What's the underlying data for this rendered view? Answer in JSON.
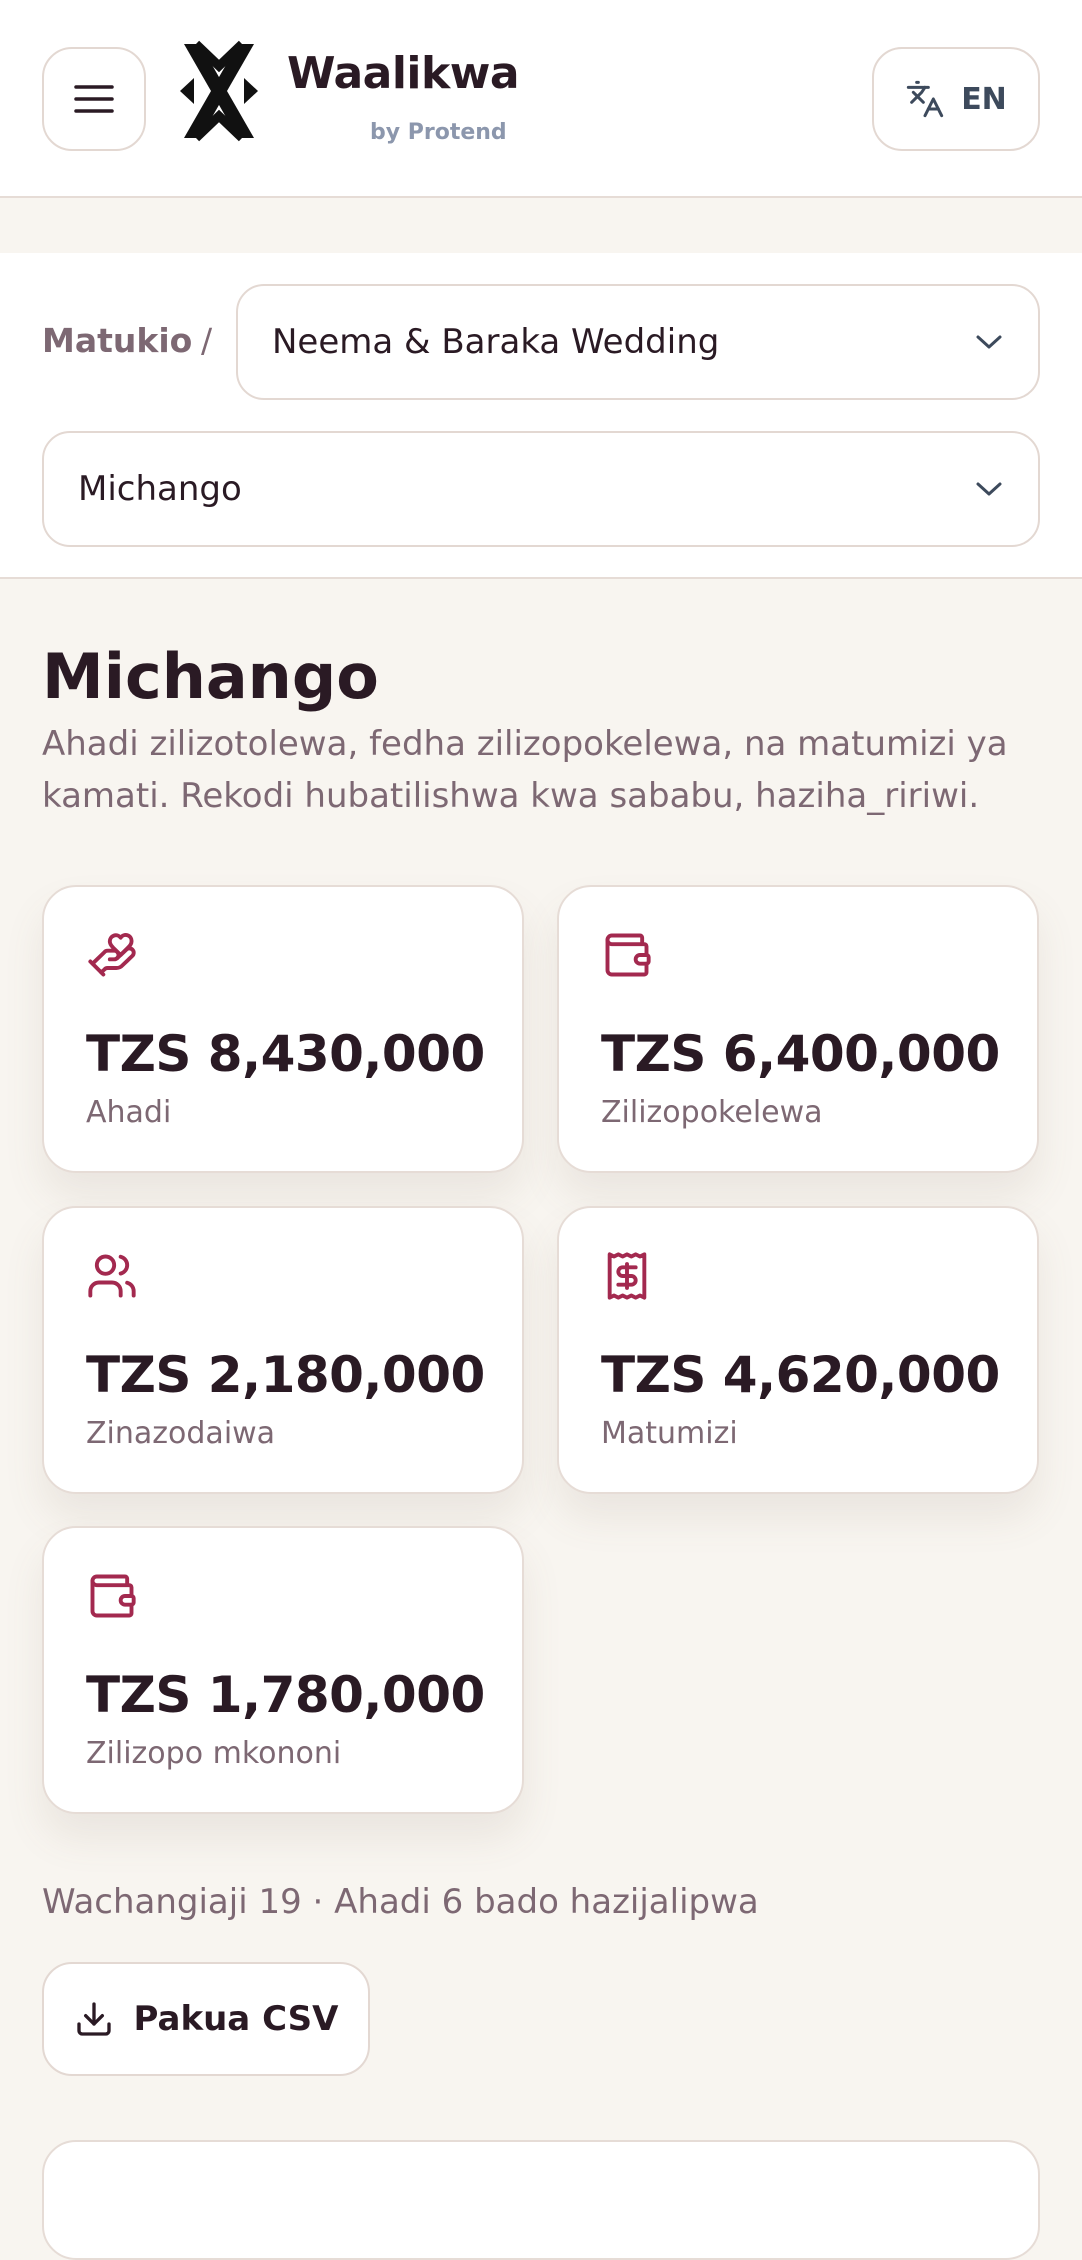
{
  "header": {
    "brand_name": "Waalikwa",
    "brand_sub": "by Protend",
    "language": "EN",
    "menu_icon": "hamburger-menu-icon",
    "language_icon": "translate-icon"
  },
  "subnav": {
    "breadcrumb": "Matukio",
    "separator": "/",
    "event_select": "Neema & Baraka Wedding",
    "section_select": "Michango"
  },
  "page": {
    "title": "Michango",
    "description": "Ahadi zilizotolewa, fedha zilizopokelewa, na matumizi ya kamati. Rekodi hubatilishwa kwa sababu, haziha_ririwi."
  },
  "stats": [
    {
      "icon": "hand-pledge-icon",
      "amount": "TZS 8,430,000",
      "label": "Ahadi"
    },
    {
      "icon": "wallet-icon",
      "amount": "TZS 6,400,000",
      "label": "Zilizopokelewa"
    },
    {
      "icon": "users-icon",
      "amount": "TZS 2,180,000",
      "label": "Zinazodaiwa"
    },
    {
      "icon": "receipt-icon",
      "amount": "TZS 4,620,000",
      "label": "Matumizi"
    },
    {
      "icon": "wallet-icon",
      "amount": "TZS 1,780,000",
      "label": "Zilizopo mkononi"
    }
  ],
  "summary": "Wachangiaji 19 · Ahadi 6 bado hazijalipwa",
  "actions": {
    "download_csv": "Pakua CSV",
    "download_icon": "download-icon"
  },
  "colors": {
    "accent": "#a3294f",
    "background": "#f8f5f0",
    "text": "#2a1a24",
    "muted": "#7d6873"
  }
}
